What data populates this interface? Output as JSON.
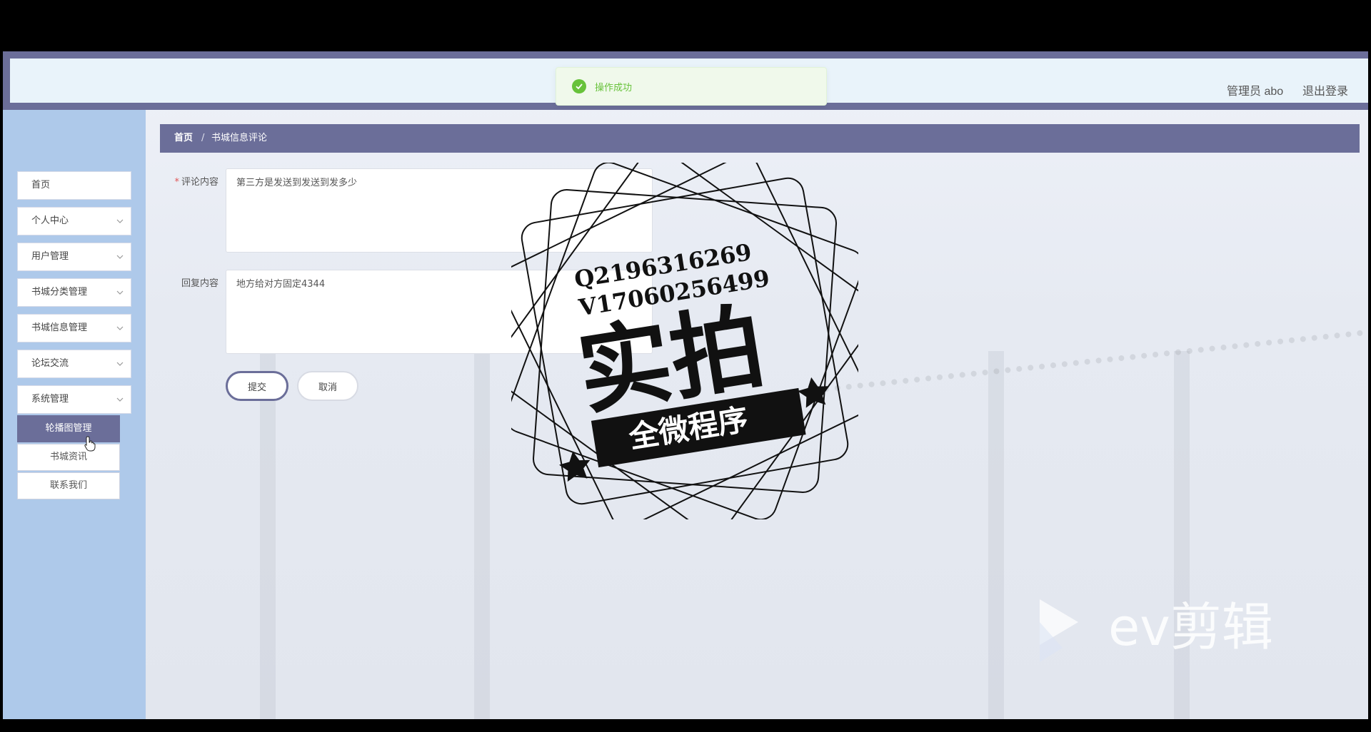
{
  "header": {
    "admin_label": "管理员 abo",
    "logout_label": "退出登录"
  },
  "toast": {
    "icon": "check-circle-icon",
    "message": "操作成功"
  },
  "sidebar": {
    "items": [
      {
        "label": "首页"
      },
      {
        "label": "个人中心"
      },
      {
        "label": "用户管理"
      },
      {
        "label": "书城分类管理"
      },
      {
        "label": "书城信息管理"
      },
      {
        "label": "论坛交流"
      },
      {
        "label": "系统管理"
      }
    ],
    "submenu": [
      {
        "label": "轮播图管理",
        "active": true
      },
      {
        "label": "书城资讯",
        "active": false
      },
      {
        "label": "联系我们",
        "active": false
      }
    ]
  },
  "breadcrumb": {
    "home": "首页",
    "separator": "/",
    "current": "书城信息评论"
  },
  "form": {
    "comment": {
      "required_mark": "*",
      "label": "评论内容",
      "value": "第三方是发送到发送到发多少"
    },
    "reply": {
      "label": "回复内容",
      "value": "地方给对方固定4344"
    },
    "submit_label": "提交",
    "cancel_label": "取消"
  },
  "watermark": {
    "qq": "Q2196316269",
    "wechat": "V17060256499",
    "title": "实拍",
    "ribbon": "全微程序",
    "ev_text": "ev剪辑"
  },
  "colors": {
    "primary": "#6b6e99",
    "sidebar_bg": "#aec9ea",
    "header_bg": "#e9f3fa",
    "success": "#67c23a"
  }
}
